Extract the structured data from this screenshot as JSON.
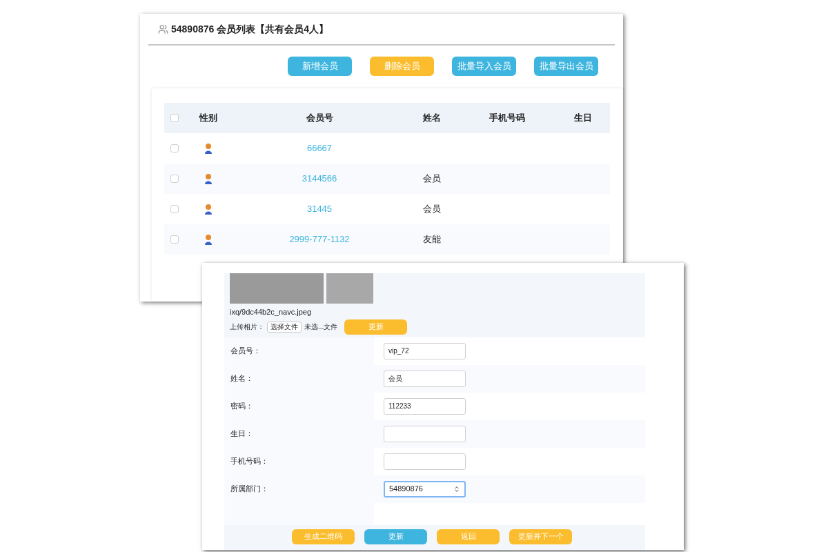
{
  "list_window": {
    "title": "54890876 会员列表【共有会员4人】",
    "buttons": [
      {
        "label": "新增会员",
        "kind": "primary"
      },
      {
        "label": "删除会员",
        "kind": "warning"
      },
      {
        "label": "批量导入会员",
        "kind": "primary"
      },
      {
        "label": "批量导出会员",
        "kind": "primary"
      }
    ],
    "table": {
      "header_checked": false,
      "columns": [
        "性别",
        "会员号",
        "姓名",
        "手机号码",
        "生日"
      ],
      "rows": [
        {
          "checked": false,
          "member_no": "66667"
        },
        {
          "checked": false,
          "member_no": "3144566",
          "name": "会员"
        },
        {
          "checked": false,
          "member_no": "31445",
          "name": "会员"
        },
        {
          "checked": false,
          "member_no": "2999-777-1132",
          "name": "友能"
        }
      ]
    }
  },
  "edit_window": {
    "photo_filename": "ixq/9dc44b2c_navc.jpeg",
    "upload": {
      "label": "上传相片：",
      "choose_button": "选择文件",
      "status": "未选...文件",
      "update_button": "更新"
    },
    "fields": [
      {
        "label": "会员号：",
        "kind": "text",
        "value": "vip_72"
      },
      {
        "label": "姓名：",
        "kind": "text",
        "value": "会员"
      },
      {
        "label": "密码：",
        "kind": "text",
        "value": "112233"
      },
      {
        "label": "生日：",
        "kind": "text"
      },
      {
        "label": "手机号码：",
        "kind": "text"
      },
      {
        "label": "所属部门：",
        "kind": "select",
        "value": "54890876"
      }
    ],
    "buttons": [
      {
        "label": "生成二维码",
        "kind": "warning"
      },
      {
        "label": "更新",
        "kind": "primary"
      },
      {
        "label": "返回",
        "kind": "warning"
      },
      {
        "label": "更新并下一个",
        "kind": "warning"
      }
    ]
  }
}
